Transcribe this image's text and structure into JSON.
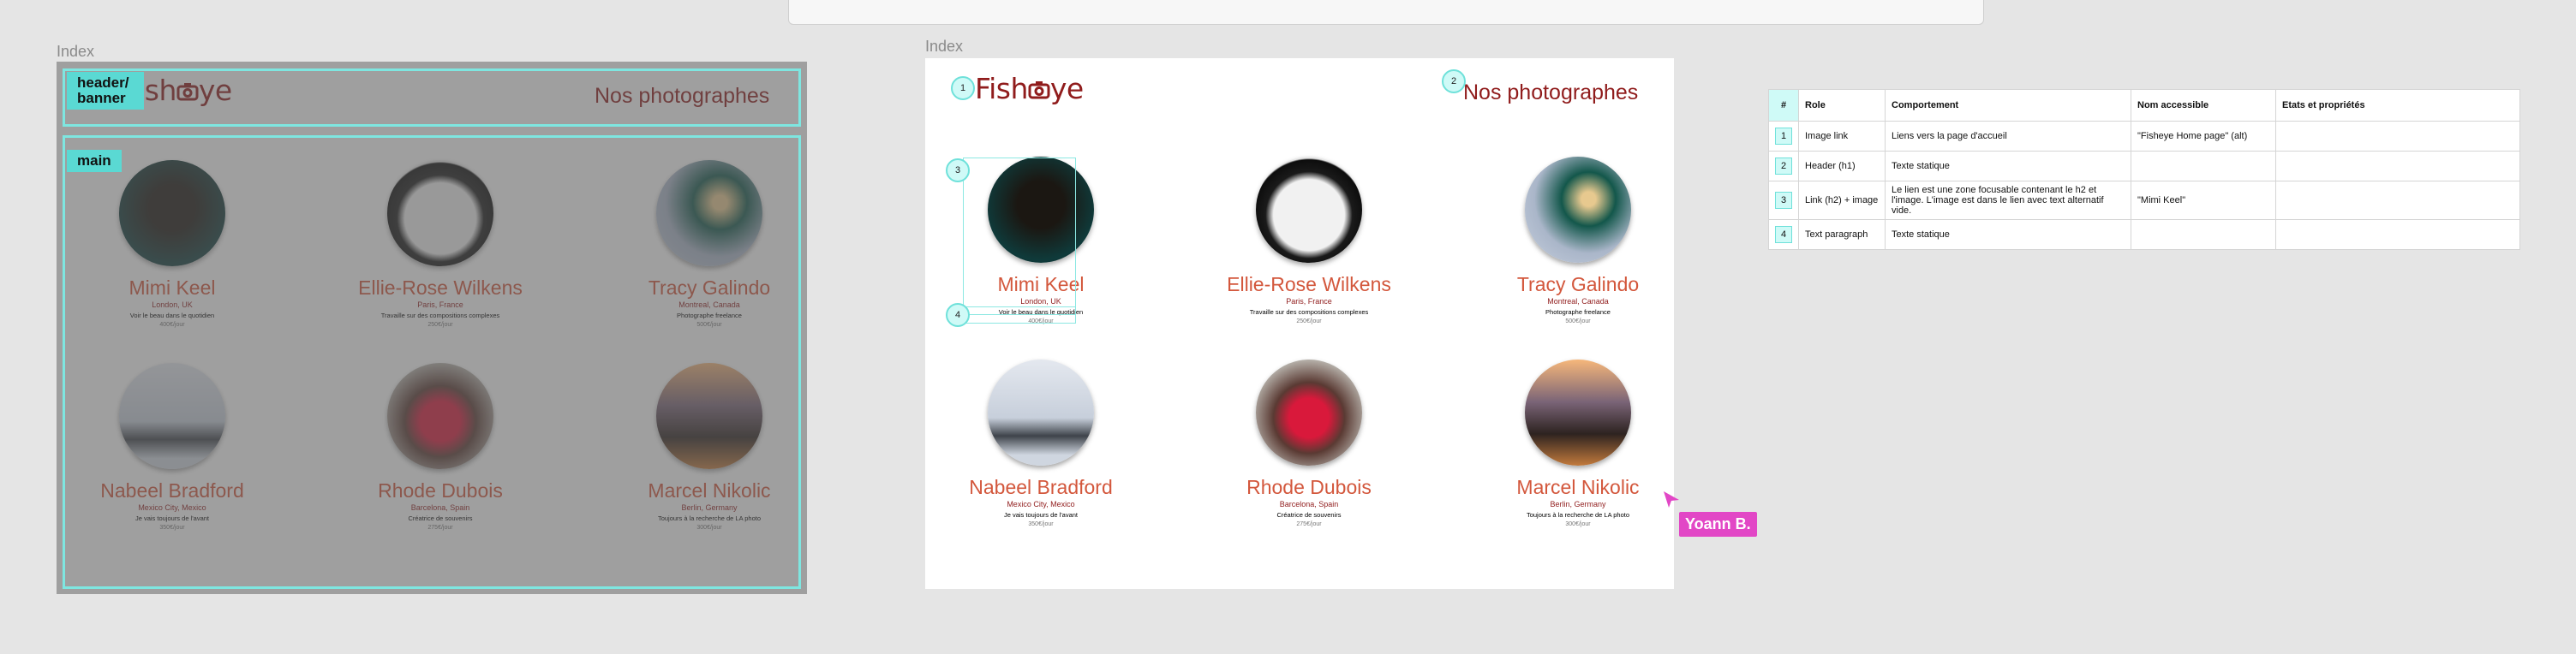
{
  "frames": {
    "left_label": "Index",
    "right_label": "Index"
  },
  "header": {
    "logo_text": "Fisheye",
    "logo_prefix": "Fish",
    "logo_suffix": "ye",
    "title": "Nos photographes"
  },
  "annotations": {
    "header_tag": "header/ banner",
    "main_tag": "main",
    "markers": [
      "1",
      "2",
      "3",
      "4"
    ]
  },
  "photographers": [
    {
      "name": "Mimi Keel",
      "location": "London, UK",
      "tagline": "Voir le beau dans le quotidien",
      "price": "400€/jour"
    },
    {
      "name": "Ellie-Rose Wilkens",
      "location": "Paris, France",
      "tagline": "Travaille sur des compositions complexes",
      "price": "250€/jour"
    },
    {
      "name": "Tracy Galindo",
      "location": "Montreal, Canada",
      "tagline": "Photographe freelance",
      "price": "500€/jour"
    },
    {
      "name": "Nabeel Bradford",
      "location": "Mexico City, Mexico",
      "tagline": "Je vais toujours de l'avant",
      "price": "350€/jour"
    },
    {
      "name": "Rhode Dubois",
      "location": "Barcelona, Spain",
      "tagline": "Créatrice de souvenirs",
      "price": "275€/jour"
    },
    {
      "name": "Marcel Nikolic",
      "location": "Berlin, Germany",
      "tagline": "Toujours à la recherche de LA photo",
      "price": "300€/jour"
    }
  ],
  "table": {
    "headers": [
      "#",
      "Role",
      "Comportement",
      "Nom accessible",
      "Etats et propriétés"
    ],
    "rows": [
      [
        "1",
        "Image link",
        "Liens vers la page d'accueil",
        "\"Fisheye Home page\" (alt)",
        ""
      ],
      [
        "2",
        "Header (h1)",
        "Texte statique",
        "",
        ""
      ],
      [
        "3",
        "Link (h2) + image",
        "Le lien est une zone focusable contenant le h2 et l'image. L'image est dans le lien avec text alternatif vide.",
        "\"Mimi Keel\"",
        ""
      ],
      [
        "4",
        "Text paragraph",
        "Texte statique",
        "",
        ""
      ]
    ]
  },
  "cursor": {
    "user": "Yoann B."
  },
  "colors": {
    "brand": "#901c1c",
    "name": "#d3573c",
    "annotation": "#5ad9d3",
    "cursor": "#e247c6"
  }
}
